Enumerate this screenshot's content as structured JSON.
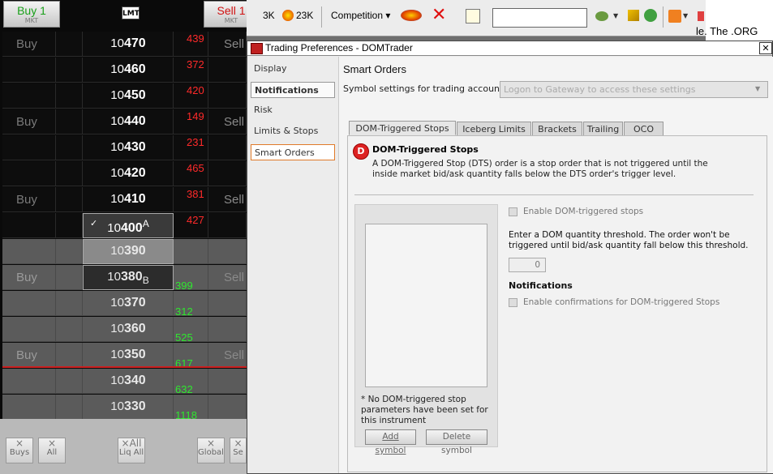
{
  "ladder": {
    "buy_button": {
      "label": "Buy 1",
      "sub": "MKT"
    },
    "sell_button": {
      "label": "Sell 1",
      "sub": "MKT"
    },
    "order_type_badge": "LMT",
    "buy_label": "Buy",
    "sell_label": "Sell",
    "rows": [
      {
        "prefix": "10",
        "price": "470",
        "ask": "439",
        "bid": "",
        "buy": true,
        "shade": "dark"
      },
      {
        "prefix": "10",
        "price": "460",
        "ask": "372",
        "bid": "",
        "buy": false,
        "shade": "dark"
      },
      {
        "prefix": "10",
        "price": "450",
        "ask": "420",
        "bid": "",
        "buy": false,
        "shade": "dark"
      },
      {
        "prefix": "10",
        "price": "440",
        "ask": "149",
        "bid": "",
        "buy": true,
        "shade": "dark"
      },
      {
        "prefix": "10",
        "price": "430",
        "ask": "231",
        "bid": "",
        "buy": false,
        "shade": "dark"
      },
      {
        "prefix": "10",
        "price": "420",
        "ask": "465",
        "bid": "",
        "buy": false,
        "shade": "dark"
      },
      {
        "prefix": "10",
        "price": "410",
        "ask": "381",
        "bid": "",
        "buy": true,
        "shade": "dark"
      },
      {
        "prefix": "10",
        "price": "400",
        "ask": "427",
        "bid": "",
        "buy": false,
        "shade": "dark",
        "marker": "A",
        "check": "✓"
      },
      {
        "prefix": "10",
        "price": "390",
        "ask": "",
        "bid": "",
        "buy": false,
        "shade": "grey"
      },
      {
        "prefix": "10",
        "price": "380",
        "ask": "",
        "bid": "399",
        "buy": true,
        "shade": "grey",
        "marker": "B"
      },
      {
        "prefix": "10",
        "price": "370",
        "ask": "",
        "bid": "312",
        "buy": false,
        "shade": "grey"
      },
      {
        "prefix": "10",
        "price": "360",
        "ask": "",
        "bid": "525",
        "buy": false,
        "shade": "grey"
      },
      {
        "prefix": "10",
        "price": "350",
        "ask": "",
        "bid": "617",
        "buy": true,
        "shade": "grey"
      },
      {
        "prefix": "10",
        "price": "340",
        "ask": "",
        "bid": "632",
        "buy": false,
        "shade": "grey"
      },
      {
        "prefix": "10",
        "price": "330",
        "ask": "",
        "bid": "1118",
        "buy": false,
        "shade": "grey"
      }
    ],
    "bottom_buttons": [
      {
        "icon": "×",
        "label": "Buys"
      },
      {
        "icon": "×",
        "label": "All"
      },
      {
        "icon": "×All",
        "label": "Liq All"
      },
      {
        "icon": "×",
        "label": "Global"
      },
      {
        "icon": "×",
        "label": "Se"
      }
    ]
  },
  "toolbar": {
    "count1": "3K",
    "count2": "23K",
    "competition": "Competition ▾",
    "search_value": ""
  },
  "webpage_fragment": "le. The .ORG",
  "dialog": {
    "title": "Trading Preferences - DOMTrader",
    "close": "✕",
    "nav": [
      "Display",
      "Notifications",
      "Risk",
      "Limits & Stops",
      "Smart Orders"
    ],
    "heading": "Smart Orders",
    "account_label": "Symbol settings for trading account:",
    "account_placeholder": "Logon to Gateway to access these settings",
    "tabs": [
      "DOM-Triggered Stops",
      "Iceberg Limits",
      "Brackets",
      "Trailing",
      "OCO"
    ],
    "dts_title": "DOM-Triggered Stops",
    "dts_desc": "A DOM-Triggered Stop (DTS) order is a stop order that is not triggered until the inside market bid/ask quantity falls below the DTS order's trigger level.",
    "no_params": "* No DOM-triggered stop parameters have been set for this instrument",
    "add_symbol": "Add symbol",
    "delete_symbol": "Delete symbol",
    "enable_dts": "Enable DOM-triggered stops",
    "threshold_text": "Enter a DOM quantity threshold. The order won't be triggered until bid/ask quantity fall below this threshold.",
    "threshold_value": "0",
    "notifications_heading": "Notifications",
    "enable_confirmations": "Enable confirmations for DOM-triggered Stops"
  },
  "colors": {
    "ask": "#ff2a2a",
    "bid": "#2ee82e",
    "selected_nav_border": "#e07a2a"
  }
}
